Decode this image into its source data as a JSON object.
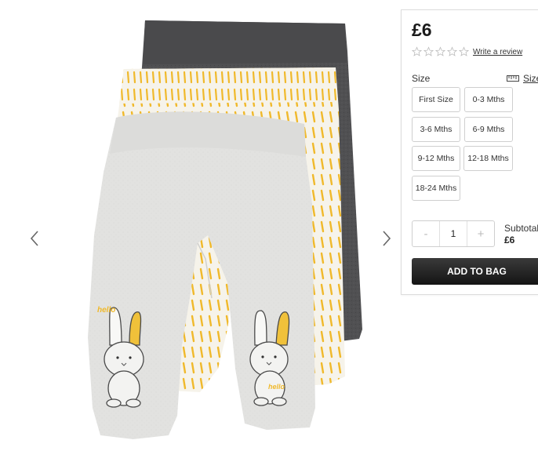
{
  "product": {
    "image_name": "baby-leggings-3-pack",
    "price": "£6",
    "rating_stars": 0,
    "write_review": "Write a review"
  },
  "size": {
    "label": "Size",
    "guide_label": "Size",
    "options": [
      "First Size",
      "0-3 Mths",
      "3-6 Mths",
      "6-9 Mths",
      "9-12 Mths",
      "12-18 Mths",
      "18-24 Mths"
    ]
  },
  "quantity": {
    "minus": "-",
    "value": "1",
    "plus": "+"
  },
  "subtotal": {
    "label": "Subtotal",
    "value": "£6"
  },
  "add_to_bag": "ADD TO BAG",
  "colors": {
    "button_bg": "#1f1f1f",
    "yellow": "#f0b92b",
    "dark_grey": "#4d4d4f",
    "light_grey": "#e4e4e2"
  }
}
